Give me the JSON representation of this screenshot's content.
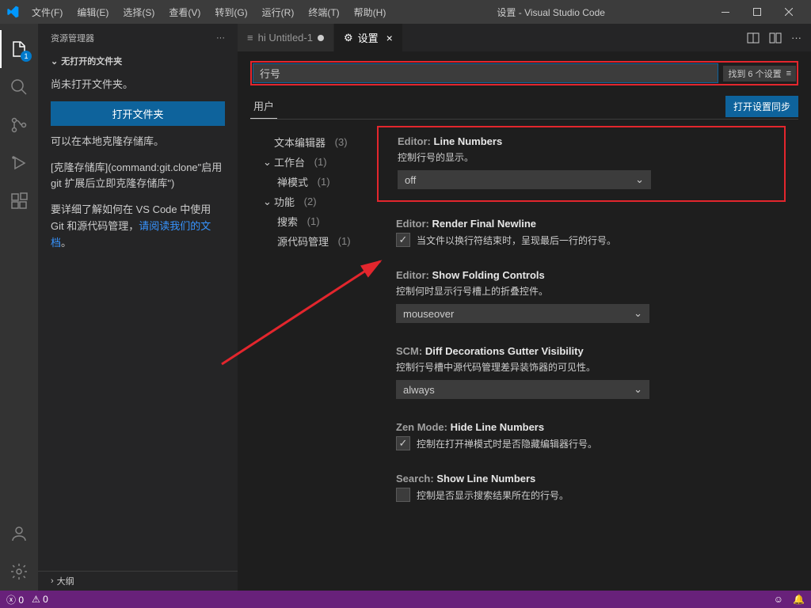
{
  "window": {
    "title": "设置 - Visual Studio Code"
  },
  "menubar": [
    "文件(F)",
    "编辑(E)",
    "选择(S)",
    "查看(V)",
    "转到(G)",
    "运行(R)",
    "终端(T)",
    "帮助(H)"
  ],
  "activitybar": {
    "explorer_badge": "1"
  },
  "sidebar": {
    "title": "资源管理器",
    "section": "无打开的文件夹",
    "line1": "尚未打开文件夹。",
    "open_folder_btn": "打开文件夹",
    "line2": "可以在本地克隆存储库。",
    "line3_prefix": "[克隆存储库](command:git.clone\"启用 git 扩展后立即克隆存储库\")",
    "line4_a": "要详细了解如何在 VS Code 中使用 Git 和源代码管理，",
    "line4_link": "请阅读我们的文档",
    "line4_b": "。",
    "outline": "大纲"
  },
  "tabs": {
    "tab1": "hi  Untitled-1",
    "tab2": "设置"
  },
  "settings": {
    "search_value": "行号",
    "search_status": "找到 6 个设置",
    "scope_user": "用户",
    "sync_btn": "打开设置同步",
    "toc": {
      "text_editor": "文本编辑器",
      "text_editor_count": "(3)",
      "workbench": "工作台",
      "workbench_count": "(1)",
      "zen": "禅模式",
      "zen_count": "(1)",
      "features": "功能",
      "features_count": "(2)",
      "search": "搜索",
      "search_count": "(1)",
      "scm": "源代码管理",
      "scm_count": "(1)"
    },
    "items": {
      "lineNumbers": {
        "scope": "Editor:",
        "name": "Line Numbers",
        "desc": "控制行号的显示。",
        "value": "off"
      },
      "renderFinalNewline": {
        "scope": "Editor:",
        "name": "Render Final Newline",
        "desc": "当文件以换行符结束时，呈现最后一行的行号。",
        "checked": true
      },
      "showFolding": {
        "scope": "Editor:",
        "name": "Show Folding Controls",
        "desc": "控制何时显示行号槽上的折叠控件。",
        "value": "mouseover"
      },
      "scmGutter": {
        "scope": "SCM:",
        "name": "Diff Decorations Gutter Visibility",
        "desc": "控制行号槽中源代码管理差异装饰器的可见性。",
        "value": "always"
      },
      "zenHide": {
        "scope": "Zen Mode:",
        "name": "Hide Line Numbers",
        "desc": "控制在打开禅模式时是否隐藏编辑器行号。",
        "checked": true
      },
      "searchShow": {
        "scope": "Search:",
        "name": "Show Line Numbers",
        "desc": "控制是否显示搜索结果所在的行号。",
        "checked": false
      }
    }
  },
  "statusbar": {
    "errors": "0",
    "warnings": "0"
  }
}
